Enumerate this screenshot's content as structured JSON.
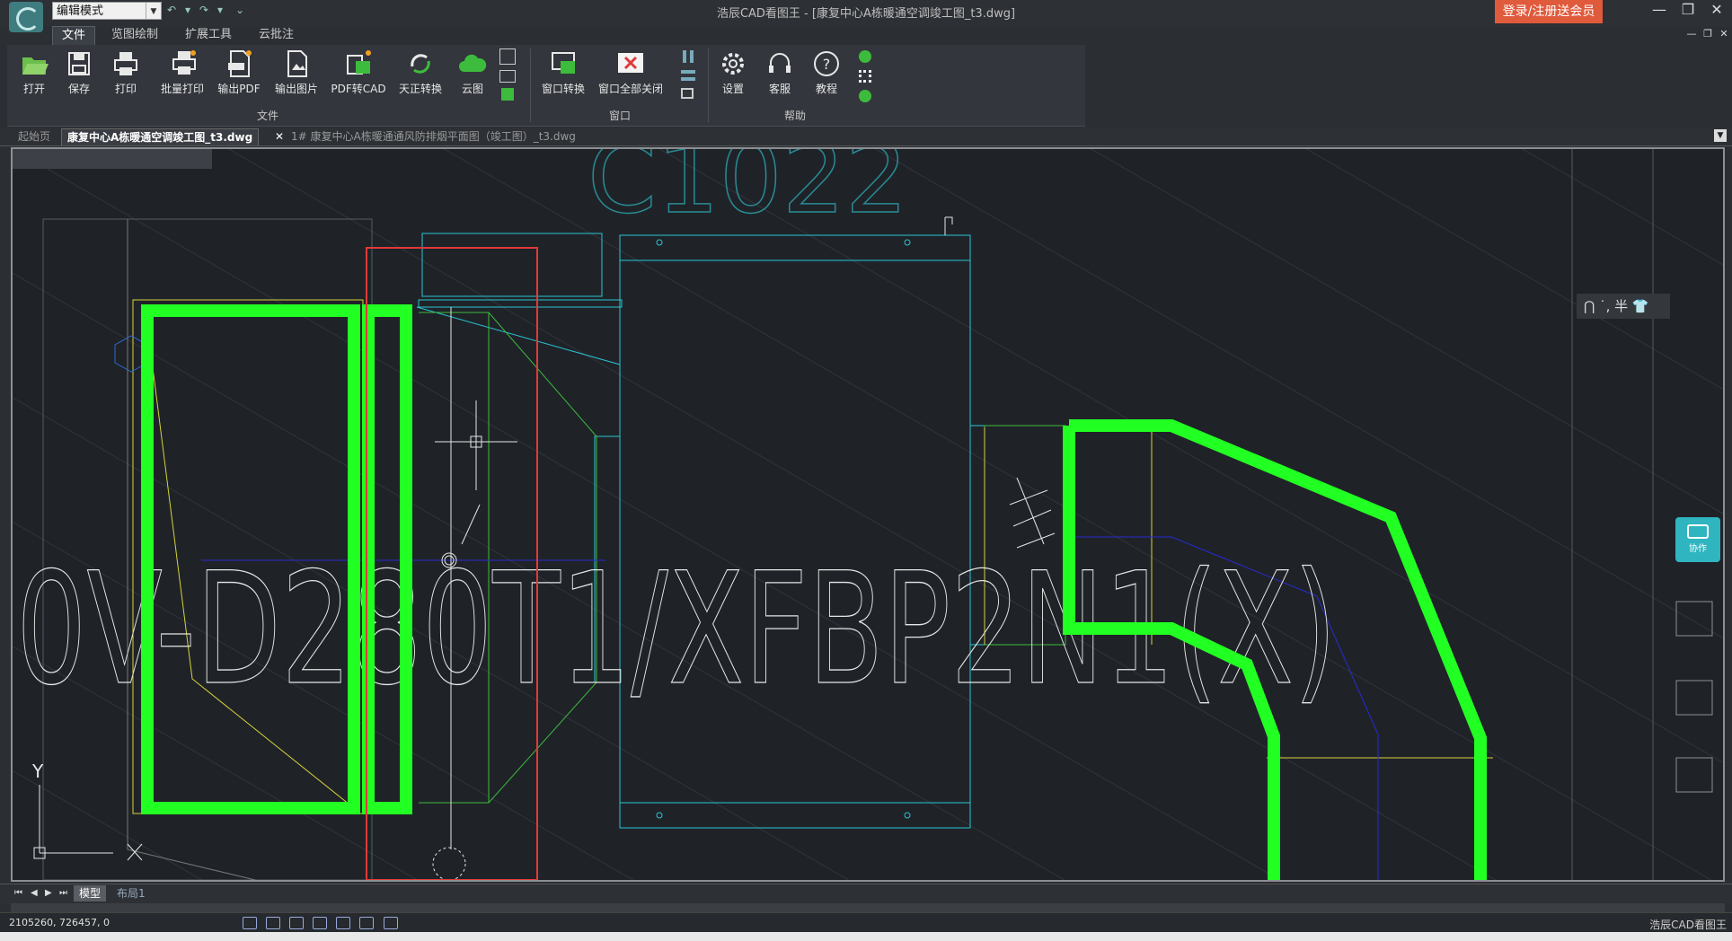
{
  "app": {
    "mode_select": "编辑模式",
    "window_title": "浩辰CAD看图王 - [康复中心A栋暖通空调竣工图_t3.dwg]",
    "login_button": "登录/注册送会员",
    "brand_status": "浩辰CAD看图王"
  },
  "menu": {
    "items": [
      "文件",
      "览图绘制",
      "扩展工具",
      "云批注"
    ],
    "active_index": 0
  },
  "ribbon": {
    "file_group": {
      "label": "文件",
      "buttons": [
        {
          "label": "打开",
          "icon": "folder-open-icon"
        },
        {
          "label": "保存",
          "icon": "save-icon"
        },
        {
          "label": "打印",
          "icon": "print-icon"
        },
        {
          "label": "批量打印",
          "icon": "batch-print-icon"
        },
        {
          "label": "输出PDF",
          "icon": "pdf-export-icon"
        },
        {
          "label": "输出图片",
          "icon": "image-export-icon"
        },
        {
          "label": "PDF转CAD",
          "icon": "pdf-to-cad-icon"
        },
        {
          "label": "天正转换",
          "icon": "tangent-convert-icon"
        },
        {
          "label": "云图",
          "icon": "cloud-icon"
        }
      ]
    },
    "window_group": {
      "label": "窗口",
      "buttons": [
        {
          "label": "窗口转换",
          "icon": "window-switch-icon"
        },
        {
          "label": "窗口全部关闭",
          "icon": "window-close-all-icon"
        }
      ]
    },
    "help_group": {
      "label": "帮助",
      "buttons": [
        {
          "label": "设置",
          "icon": "gear-icon"
        },
        {
          "label": "客服",
          "icon": "headset-icon"
        },
        {
          "label": "教程",
          "icon": "help-icon"
        }
      ]
    }
  },
  "doc_tabs": [
    {
      "label": "起始页"
    },
    {
      "label": "康复中心A栋暖通空调竣工图_t3.dwg",
      "active": true
    },
    {
      "label": "1# 康复中心A栋暖通通风防排烟平面图（竣工图）_t3.dwg"
    }
  ],
  "drawing": {
    "big_text": "0V-D280T1/XFBP2N1(X)",
    "top_text": "C1022",
    "axis_y": "Y"
  },
  "float_tools": {
    "label": "⋂ ˙, 半 👕"
  },
  "collab": {
    "label": "协作"
  },
  "layout_tabs": [
    {
      "label": "模型",
      "active": true
    },
    {
      "label": "布局1"
    }
  ],
  "status": {
    "coordinates": "2105260, 726457, 0"
  },
  "colors": {
    "green_duct": "#22ff22",
    "cyan_line": "#2ac4d4",
    "red_box": "#e03a3a",
    "yellow_line": "#d8d23a",
    "blue_line": "#2a2ad0",
    "canvas_bg": "#1f2328"
  }
}
